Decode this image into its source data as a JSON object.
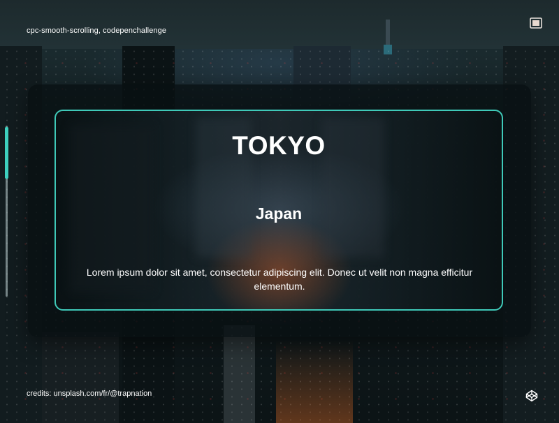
{
  "header": {
    "tags": "cpc-smooth-scrolling, codepenchallenge"
  },
  "card": {
    "title": "TOKYO",
    "subtitle": "Japan",
    "description": "Lorem ipsum dolor sit amet, consectetur adipiscing elit. Donec ut velit non magna efficitur elementum."
  },
  "footer": {
    "credits": "credits: unsplash.com/fr/@trapnation"
  },
  "icons": {
    "fullscreen": "fullscreen-icon",
    "codepen": "codepen-icon"
  },
  "scroll": {
    "progress": 0.3
  },
  "colors": {
    "accent": "#3fc9b8",
    "scroll_thumb": "#3fd1c0",
    "text": "#ffffff"
  }
}
